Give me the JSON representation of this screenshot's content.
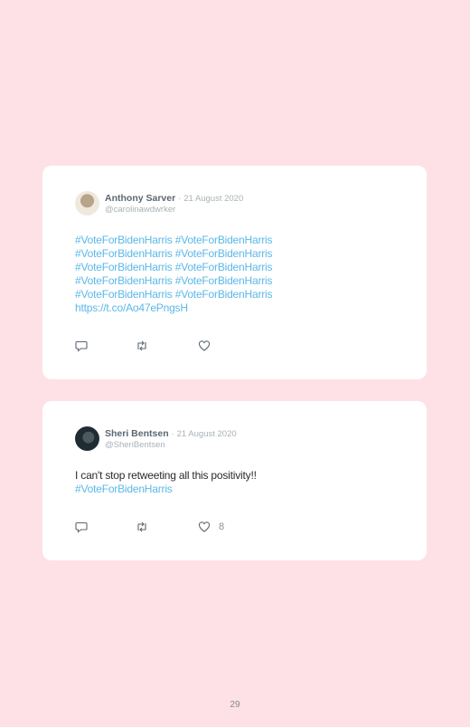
{
  "tweets": [
    {
      "name": "Anthony Sarver",
      "separator": "·",
      "date": "21 August 2020",
      "handle": "@carolinawdwrker",
      "lines": [
        {
          "text": "#VoteForBidenHarris #VoteForBidenHarris",
          "type": "link"
        },
        {
          "text": "#VoteForBidenHarris #VoteForBidenHarris",
          "type": "link"
        },
        {
          "text": "#VoteForBidenHarris #VoteForBidenHarris",
          "type": "link"
        },
        {
          "text": "#VoteForBidenHarris #VoteForBidenHarris",
          "type": "link"
        },
        {
          "text": "#VoteForBidenHarris #VoteForBidenHarris",
          "type": "link"
        },
        {
          "text": "https://t.co/Ao47ePngsH",
          "type": "link"
        }
      ],
      "like_count": ""
    },
    {
      "name": "Sheri Bentsen",
      "separator": "·",
      "date": "21 August 2020",
      "handle": "@SheriBentsen",
      "lines": [
        {
          "text": "I can't stop retweeting all this positivity!!",
          "type": "plain"
        },
        {
          "text": "#VoteForBidenHarris",
          "type": "link"
        }
      ],
      "like_count": "8"
    }
  ],
  "page_number": "29",
  "colors": {
    "background": "#fde1e6",
    "card": "#ffffff",
    "link": "#5bb8e8",
    "name": "#5b6770",
    "muted": "#a9b1b6"
  },
  "icons": {
    "reply": "reply-icon",
    "retweet": "retweet-icon",
    "like": "heart-icon"
  }
}
